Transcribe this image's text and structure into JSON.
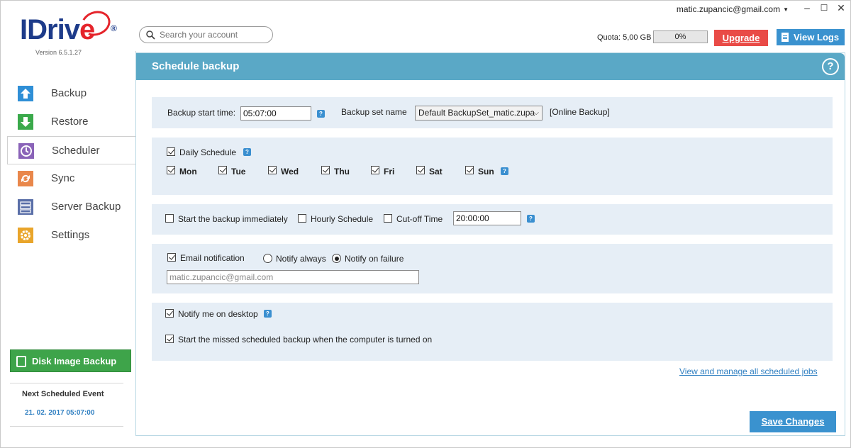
{
  "window": {
    "user_email": "matic.zupancic@gmail.com",
    "minimize": "–",
    "maximize": "☐",
    "close": "✕"
  },
  "brand": {
    "logo_i": "I",
    "logo_driv": "Driv",
    "logo_e": "e",
    "registered": "®",
    "version": "Version 6.5.1.27"
  },
  "search": {
    "placeholder": "Search your account",
    "value": ""
  },
  "quota": {
    "label": "Quota: 5,00 GB",
    "percent": "0%",
    "fraction": 0.0
  },
  "header_buttons": {
    "upgrade": "Upgrade",
    "view_logs": "View Logs"
  },
  "sidebar": {
    "items": [
      {
        "label": "Backup",
        "icon": "backup-arrow-up-icon",
        "color": "#2f8fd6"
      },
      {
        "label": "Restore",
        "icon": "restore-arrow-down-icon",
        "color": "#3aa94b"
      },
      {
        "label": "Scheduler",
        "icon": "scheduler-clock-icon",
        "color": "#8a63b8",
        "active": true
      },
      {
        "label": "Sync",
        "icon": "sync-icon",
        "color": "#e9874b"
      },
      {
        "label": "Server Backup",
        "icon": "server-icon",
        "color": "#5a6fa8"
      },
      {
        "label": "Settings",
        "icon": "settings-gear-icon",
        "color": "#e9a52b"
      }
    ],
    "disk_image_button": "Disk Image Backup",
    "next_event_title": "Next Scheduled Event",
    "next_event_date": "21. 02. 2017 05:07:00"
  },
  "panel": {
    "title": "Schedule  backup",
    "help": "?",
    "start_time_label": "Backup start time:",
    "start_time_value": "05:07:00",
    "backup_set_label": "Backup set name",
    "backup_set_value": "Default BackupSet_matic.zupa",
    "backup_type": "[Online Backup]",
    "daily_schedule_label": "Daily Schedule",
    "daily_schedule_checked": true,
    "days": [
      {
        "label": "Mon",
        "checked": true
      },
      {
        "label": "Tue",
        "checked": true
      },
      {
        "label": "Wed",
        "checked": true
      },
      {
        "label": "Thu",
        "checked": true
      },
      {
        "label": "Fri",
        "checked": true
      },
      {
        "label": "Sat",
        "checked": true
      },
      {
        "label": "Sun",
        "checked": true
      }
    ],
    "start_immediately_label": "Start the backup immediately",
    "hourly_label": "Hourly Schedule",
    "cutoff_label": "Cut-off Time",
    "cutoff_value": "20:00:00",
    "email_notification_label": "Email notification",
    "notify_always_label": "Notify always",
    "notify_failure_label": "Notify on failure",
    "email_value": "matic.zupancic@gmail.com",
    "notify_desktop_label": "Notify me on desktop",
    "missed_backup_label": "Start the missed scheduled backup when the computer is turned on",
    "manage_link": "View and manage all scheduled jobs",
    "save_button": "Save Changes"
  }
}
